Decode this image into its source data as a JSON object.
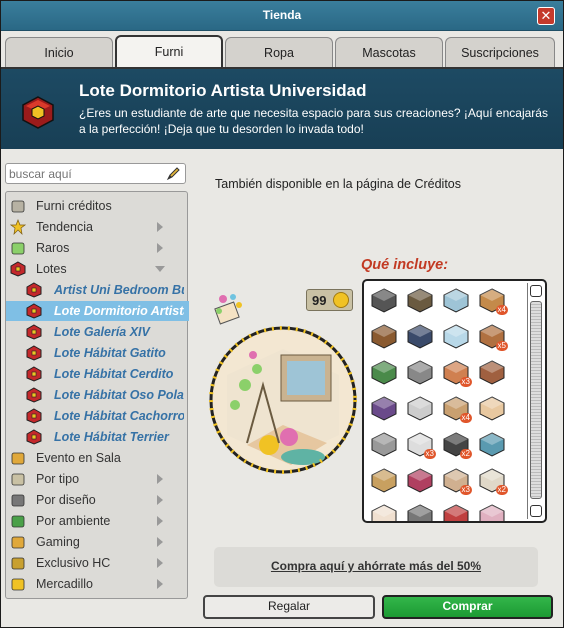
{
  "window": {
    "title": "Tienda",
    "close_icon": "close-icon"
  },
  "tabs": [
    {
      "label": "Inicio",
      "active": false
    },
    {
      "label": "Furni",
      "active": true
    },
    {
      "label": "Ropa",
      "active": false
    },
    {
      "label": "Mascotas",
      "active": false
    },
    {
      "label": "Suscripciones",
      "active": false
    }
  ],
  "banner": {
    "title": "Lote Dormitorio Artista Universidad",
    "description": "¿Eres un estudiante de arte que necesita espacio para sus creaciones? ¡Aquí encajarás a la perfección! ¡Deja que tu desorden lo invada todo!",
    "icon": "red-cube-icon"
  },
  "search": {
    "placeholder": "buscar aquí",
    "icon": "pencil-icon"
  },
  "sidebar": {
    "items": [
      {
        "label": "Furni créditos",
        "icon": "stack-icon",
        "arrow": "none"
      },
      {
        "label": "Tendencia",
        "icon": "star-icon",
        "arrow": "right"
      },
      {
        "label": "Raros",
        "icon": "exclamation-icon",
        "arrow": "right"
      },
      {
        "label": "Lotes",
        "icon": "red-cube-icon",
        "arrow": "down"
      },
      {
        "label": "Artist Uni Bedroom Bundle",
        "icon": "red-cube-icon",
        "sub": true
      },
      {
        "label": "Lote Dormitorio Artista",
        "icon": "red-cube-icon",
        "sub": true,
        "selected": true
      },
      {
        "label": "Lote Galería XIV",
        "icon": "red-cube-icon",
        "sub": true
      },
      {
        "label": "Lote Hábitat Gatito",
        "icon": "red-cube-icon",
        "sub": true
      },
      {
        "label": "Lote Hábitat Cerdito",
        "icon": "red-cube-icon",
        "sub": true
      },
      {
        "label": "Lote Hábitat Oso Polar",
        "icon": "red-cube-icon",
        "sub": true
      },
      {
        "label": "Lote Hábitat Cachorro",
        "icon": "red-cube-icon",
        "sub": true
      },
      {
        "label": "Lote Hábitat Terrier",
        "icon": "red-cube-icon",
        "sub": true
      },
      {
        "label": "Evento en Sala",
        "icon": "box-icon",
        "arrow": "none"
      },
      {
        "label": "Por tipo",
        "icon": "cup-icon",
        "arrow": "right"
      },
      {
        "label": "Por diseño",
        "icon": "columns-icon",
        "arrow": "right"
      },
      {
        "label": "Por ambiente",
        "icon": "plant-icon",
        "arrow": "right"
      },
      {
        "label": "Gaming",
        "icon": "medal-icon",
        "arrow": "right"
      },
      {
        "label": "Exclusivo HC",
        "icon": "frame-icon",
        "arrow": "right"
      },
      {
        "label": "Mercadillo",
        "icon": "coin-icon",
        "arrow": "right"
      }
    ]
  },
  "main": {
    "also_available": "También disponible en la página de Créditos",
    "includes_label": "Qué incluye:",
    "price": "99",
    "deal_link": "Compra aquí y ahórrate más del 50%",
    "items": [
      {
        "icon": "router-icon"
      },
      {
        "icon": "easel-icon"
      },
      {
        "icon": "photo-wall-icon"
      },
      {
        "icon": "shelf-icon",
        "qty": "x4"
      },
      {
        "icon": "cabinet-icon"
      },
      {
        "icon": "desk-icon"
      },
      {
        "icon": "glass-case-icon"
      },
      {
        "icon": "box-icon",
        "qty": "x5"
      },
      {
        "icon": "trellis-icon"
      },
      {
        "icon": "speaker-icon"
      },
      {
        "icon": "floor-tile-icon",
        "qty": "x3"
      },
      {
        "icon": "window-icon"
      },
      {
        "icon": "plant-icon"
      },
      {
        "icon": "paper-icon"
      },
      {
        "icon": "rug-icon",
        "qty": "x4"
      },
      {
        "icon": "table-icon"
      },
      {
        "icon": "lamp-icon"
      },
      {
        "icon": "fridge-icon",
        "qty": "x3"
      },
      {
        "icon": "dark-tile-icon",
        "qty": "x2"
      },
      {
        "icon": "fan-icon"
      },
      {
        "icon": "bed-icon"
      },
      {
        "icon": "locker-icon"
      },
      {
        "icon": "carpet-icon",
        "qty": "x3"
      },
      {
        "icon": "sign-icon",
        "qty": "x2"
      },
      {
        "icon": "paper-sheet-icon"
      },
      {
        "icon": "chair-icon"
      },
      {
        "icon": "badge-icon"
      },
      {
        "icon": "stool-icon"
      }
    ]
  },
  "buttons": {
    "gift": "Regalar",
    "buy": "Comprar"
  },
  "colors": {
    "titlebar": "#2a6885",
    "banner": "#183f55",
    "selected": "#7fbfe5",
    "buy": "#1c9a33",
    "includes": "#c23a23"
  }
}
